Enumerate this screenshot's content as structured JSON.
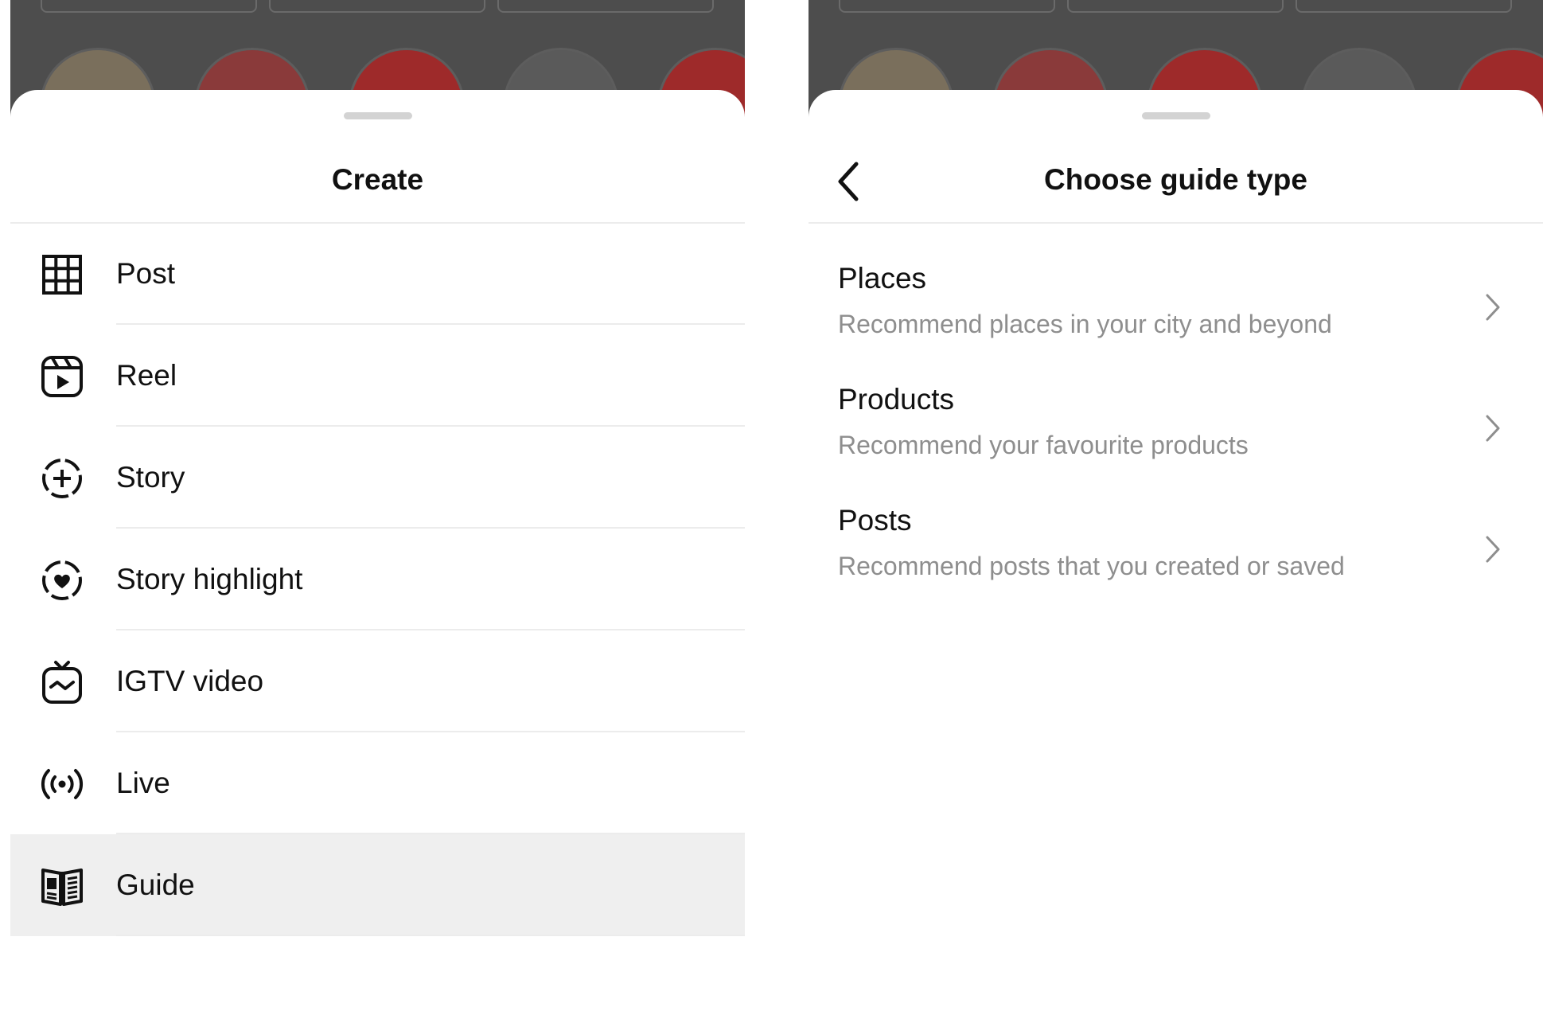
{
  "create_panel": {
    "title": "Create",
    "items": [
      {
        "label": "Post",
        "icon": "grid-icon"
      },
      {
        "label": "Reel",
        "icon": "reel-icon"
      },
      {
        "label": "Story",
        "icon": "story-add-icon"
      },
      {
        "label": "Story highlight",
        "icon": "story-highlight-icon"
      },
      {
        "label": "IGTV video",
        "icon": "igtv-icon"
      },
      {
        "label": "Live",
        "icon": "live-icon"
      },
      {
        "label": "Guide",
        "icon": "guide-icon",
        "selected": true
      }
    ]
  },
  "guide_panel": {
    "title": "Choose guide type",
    "back_icon": "back-chevron-icon",
    "items": [
      {
        "title": "Places",
        "subtitle": "Recommend places in your city and beyond"
      },
      {
        "title": "Products",
        "subtitle": "Recommend your favourite products"
      },
      {
        "title": "Posts",
        "subtitle": "Recommend posts that you created or saved"
      }
    ]
  },
  "colors": {
    "backdrop": "#4d4d4d",
    "text": "#111111",
    "subtitle": "#8e8e8e",
    "selected_row": "#efefef",
    "divider": "#ececec"
  }
}
